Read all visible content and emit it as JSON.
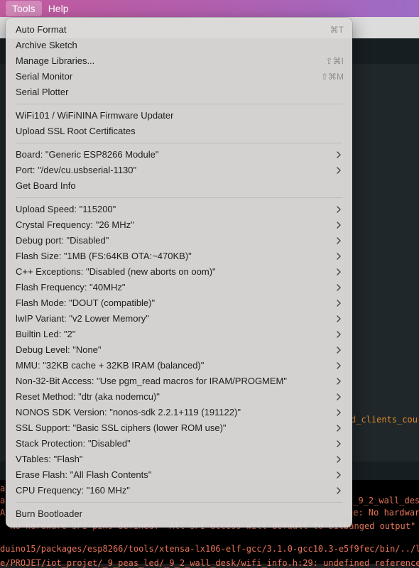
{
  "menubar": {
    "tools": "Tools",
    "help": "Help"
  },
  "editor_peek": {
    "right_code": "d_clients_cou"
  },
  "console": {
    "lines": [
      "a",
      "a",
      "A",
      " \"No hardware SPI pins defined.  All SPI access will default to bitbanged output\"",
      "duino15/packages/esp8266/tools/xtensa-lx106-elf-gcc/3.1.0-gcc10.3-e5f9fec/bin/../l",
      "e/PROJET/iot_projet/_9_peas_led/_9_2_wall_desk/wifi_info.h:29: undefined reference"
    ],
    "right_fragments": [
      "/_9_2_wall_des",
      "ge: No hardwar"
    ]
  },
  "menu": {
    "groups": [
      [
        {
          "label": "Auto Format",
          "shortcut": "⌘T"
        },
        {
          "label": "Archive Sketch",
          "shortcut": ""
        },
        {
          "label": "Manage Libraries...",
          "shortcut": "⇧⌘I"
        },
        {
          "label": "Serial Monitor",
          "shortcut": "⇧⌘M"
        },
        {
          "label": "Serial Plotter",
          "shortcut": ""
        }
      ],
      [
        {
          "label": "WiFi101 / WiFiNINA Firmware Updater",
          "shortcut": ""
        },
        {
          "label": "Upload SSL Root Certificates",
          "shortcut": ""
        }
      ],
      [
        {
          "label": "Board: \"Generic ESP8266 Module\"",
          "submenu": true
        },
        {
          "label": "Port: \"/dev/cu.usbserial-1130\"",
          "submenu": true
        },
        {
          "label": "Get Board Info",
          "submenu": false
        }
      ],
      [
        {
          "label": "Upload Speed: \"115200\"",
          "submenu": true
        },
        {
          "label": "Crystal Frequency: \"26 MHz\"",
          "submenu": true
        },
        {
          "label": "Debug port: \"Disabled\"",
          "submenu": true
        },
        {
          "label": "Flash Size: \"1MB (FS:64KB OTA:~470KB)\"",
          "submenu": true
        },
        {
          "label": "C++ Exceptions: \"Disabled (new aborts on oom)\"",
          "submenu": true
        },
        {
          "label": "Flash Frequency: \"40MHz\"",
          "submenu": true
        },
        {
          "label": "Flash Mode: \"DOUT (compatible)\"",
          "submenu": true
        },
        {
          "label": "lwIP Variant: \"v2 Lower Memory\"",
          "submenu": true
        },
        {
          "label": "Builtin Led: \"2\"",
          "submenu": true
        },
        {
          "label": "Debug Level: \"None\"",
          "submenu": true
        },
        {
          "label": "MMU: \"32KB cache + 32KB IRAM (balanced)\"",
          "submenu": true
        },
        {
          "label": "Non-32-Bit Access: \"Use pgm_read macros for IRAM/PROGMEM\"",
          "submenu": true
        },
        {
          "label": "Reset Method: \"dtr (aka nodemcu)\"",
          "submenu": true
        },
        {
          "label": "NONOS SDK Version: \"nonos-sdk 2.2.1+119 (191122)\"",
          "submenu": true
        },
        {
          "label": "SSL Support: \"Basic SSL ciphers (lower ROM use)\"",
          "submenu": true
        },
        {
          "label": "Stack Protection: \"Disabled\"",
          "submenu": true
        },
        {
          "label": "VTables: \"Flash\"",
          "submenu": true
        },
        {
          "label": "Erase Flash: \"All Flash Contents\"",
          "submenu": true
        },
        {
          "label": "CPU Frequency: \"160 MHz\"",
          "submenu": true
        }
      ],
      [
        {
          "label": "Burn Bootloader",
          "submenu": false
        }
      ]
    ]
  },
  "colors": {
    "menu_text": "#1d1d1d",
    "shortcut_text": "#8e8e8e",
    "console_text": "#e8755a"
  }
}
